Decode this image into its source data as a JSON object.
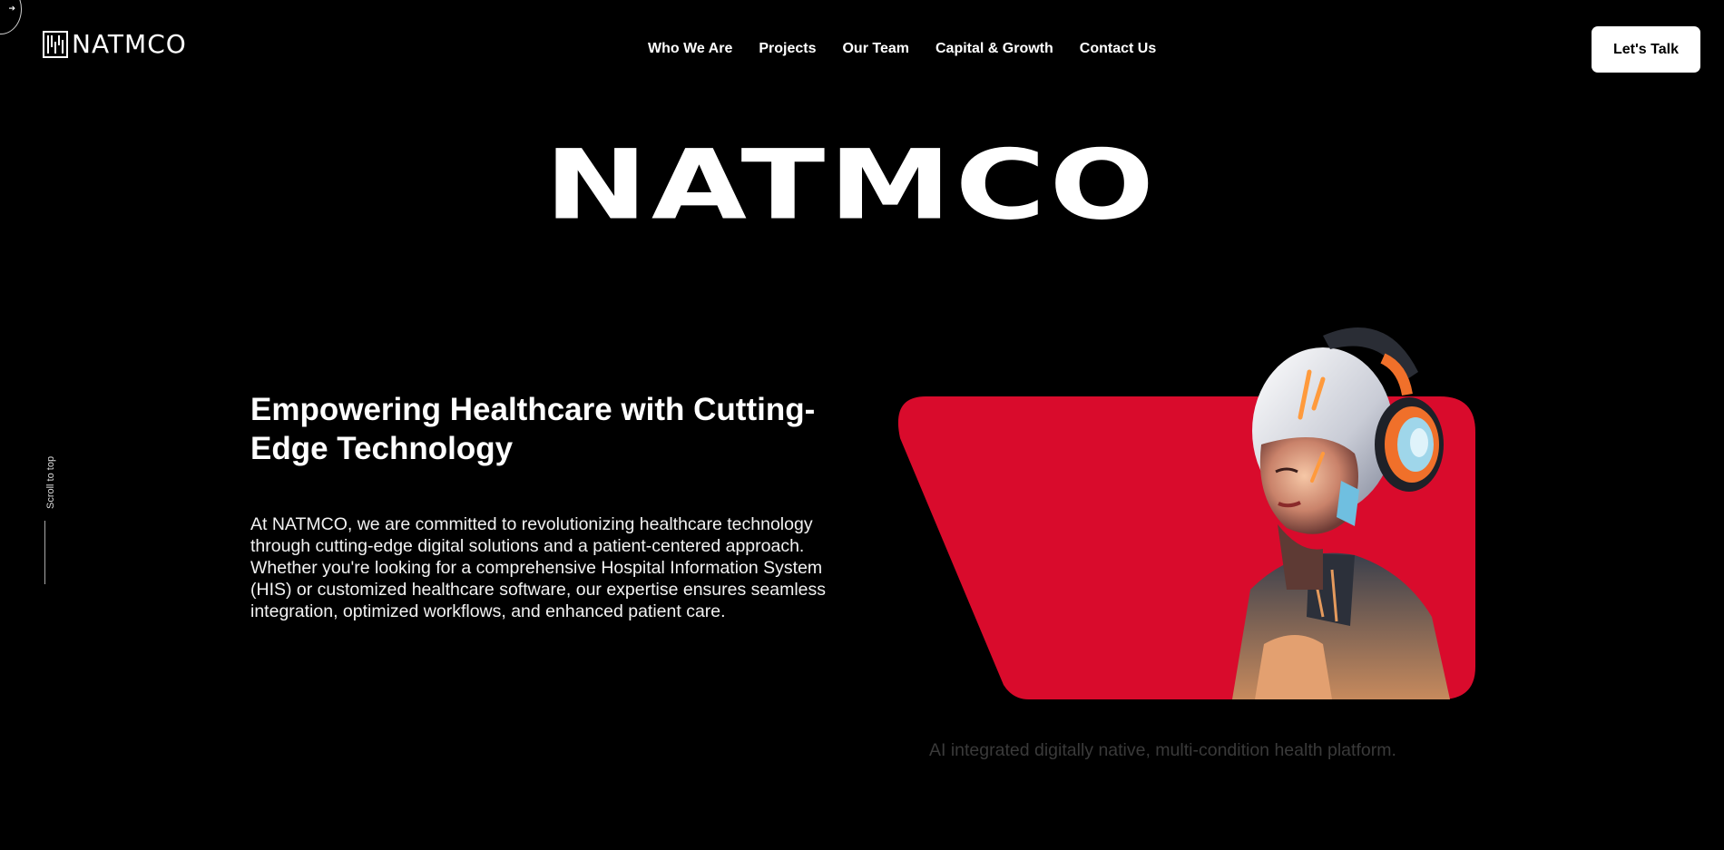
{
  "brand": {
    "name": "NATMCO"
  },
  "nav": {
    "items": [
      "Who We Are",
      "Projects",
      "Our Team",
      "Capital & Growth",
      "Contact Us"
    ]
  },
  "cta": {
    "label": "Let's Talk"
  },
  "hero": {
    "title": "NATMCO",
    "headline": "Empowering Healthcare with Cutting-Edge Technology",
    "body": "At NATMCO, we are committed to revolutionizing healthcare technology through cutting-edge digital solutions and a patient-centered approach. Whether you're looking for a comprehensive Hospital Information System (HIS) or customized healthcare software, our expertise ensures seamless integration, optimized workflows, and enhanced patient care.",
    "caption": "AI integrated digitally native, multi-condition health platform."
  },
  "scroll": {
    "label": "Scroll to top"
  },
  "icons": {
    "corner": "arrow-icon",
    "logo": "logo-mark-icon",
    "illustration": "robot-headphones-illustration"
  },
  "colors": {
    "background": "#000000",
    "accent": "#d90b2c",
    "text": "#ffffff",
    "caption": "#3a3a3a"
  }
}
